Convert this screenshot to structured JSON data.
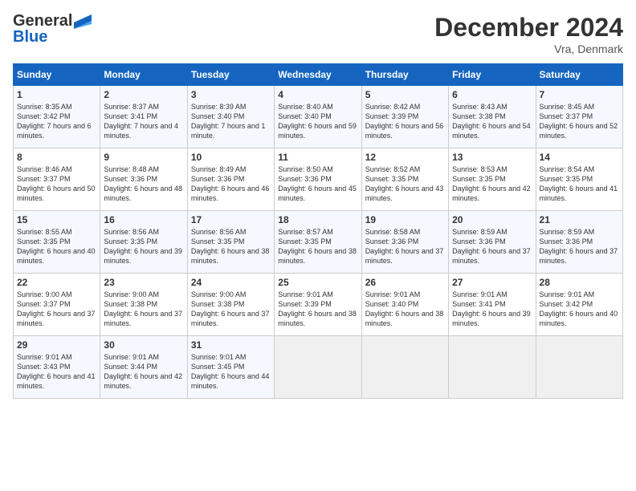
{
  "header": {
    "logo_general": "General",
    "logo_blue": "Blue",
    "month_title": "December 2024",
    "location": "Vra, Denmark"
  },
  "days_of_week": [
    "Sunday",
    "Monday",
    "Tuesday",
    "Wednesday",
    "Thursday",
    "Friday",
    "Saturday"
  ],
  "weeks": [
    [
      {
        "day": "1",
        "sunrise": "8:35 AM",
        "sunset": "3:42 PM",
        "daylight": "7 hours and 6 minutes."
      },
      {
        "day": "2",
        "sunrise": "8:37 AM",
        "sunset": "3:41 PM",
        "daylight": "7 hours and 4 minutes."
      },
      {
        "day": "3",
        "sunrise": "8:39 AM",
        "sunset": "3:40 PM",
        "daylight": "7 hours and 1 minute."
      },
      {
        "day": "4",
        "sunrise": "8:40 AM",
        "sunset": "3:40 PM",
        "daylight": "6 hours and 59 minutes."
      },
      {
        "day": "5",
        "sunrise": "8:42 AM",
        "sunset": "3:39 PM",
        "daylight": "6 hours and 56 minutes."
      },
      {
        "day": "6",
        "sunrise": "8:43 AM",
        "sunset": "3:38 PM",
        "daylight": "6 hours and 54 minutes."
      },
      {
        "day": "7",
        "sunrise": "8:45 AM",
        "sunset": "3:37 PM",
        "daylight": "6 hours and 52 minutes."
      }
    ],
    [
      {
        "day": "8",
        "sunrise": "8:46 AM",
        "sunset": "3:37 PM",
        "daylight": "6 hours and 50 minutes."
      },
      {
        "day": "9",
        "sunrise": "8:48 AM",
        "sunset": "3:36 PM",
        "daylight": "6 hours and 48 minutes."
      },
      {
        "day": "10",
        "sunrise": "8:49 AM",
        "sunset": "3:36 PM",
        "daylight": "6 hours and 46 minutes."
      },
      {
        "day": "11",
        "sunrise": "8:50 AM",
        "sunset": "3:36 PM",
        "daylight": "6 hours and 45 minutes."
      },
      {
        "day": "12",
        "sunrise": "8:52 AM",
        "sunset": "3:35 PM",
        "daylight": "6 hours and 43 minutes."
      },
      {
        "day": "13",
        "sunrise": "8:53 AM",
        "sunset": "3:35 PM",
        "daylight": "6 hours and 42 minutes."
      },
      {
        "day": "14",
        "sunrise": "8:54 AM",
        "sunset": "3:35 PM",
        "daylight": "6 hours and 41 minutes."
      }
    ],
    [
      {
        "day": "15",
        "sunrise": "8:55 AM",
        "sunset": "3:35 PM",
        "daylight": "6 hours and 40 minutes."
      },
      {
        "day": "16",
        "sunrise": "8:56 AM",
        "sunset": "3:35 PM",
        "daylight": "6 hours and 39 minutes."
      },
      {
        "day": "17",
        "sunrise": "8:56 AM",
        "sunset": "3:35 PM",
        "daylight": "6 hours and 38 minutes."
      },
      {
        "day": "18",
        "sunrise": "8:57 AM",
        "sunset": "3:35 PM",
        "daylight": "6 hours and 38 minutes."
      },
      {
        "day": "19",
        "sunrise": "8:58 AM",
        "sunset": "3:36 PM",
        "daylight": "6 hours and 37 minutes."
      },
      {
        "day": "20",
        "sunrise": "8:59 AM",
        "sunset": "3:36 PM",
        "daylight": "6 hours and 37 minutes."
      },
      {
        "day": "21",
        "sunrise": "8:59 AM",
        "sunset": "3:36 PM",
        "daylight": "6 hours and 37 minutes."
      }
    ],
    [
      {
        "day": "22",
        "sunrise": "9:00 AM",
        "sunset": "3:37 PM",
        "daylight": "6 hours and 37 minutes."
      },
      {
        "day": "23",
        "sunrise": "9:00 AM",
        "sunset": "3:38 PM",
        "daylight": "6 hours and 37 minutes."
      },
      {
        "day": "24",
        "sunrise": "9:00 AM",
        "sunset": "3:38 PM",
        "daylight": "6 hours and 37 minutes."
      },
      {
        "day": "25",
        "sunrise": "9:01 AM",
        "sunset": "3:39 PM",
        "daylight": "6 hours and 38 minutes."
      },
      {
        "day": "26",
        "sunrise": "9:01 AM",
        "sunset": "3:40 PM",
        "daylight": "6 hours and 38 minutes."
      },
      {
        "day": "27",
        "sunrise": "9:01 AM",
        "sunset": "3:41 PM",
        "daylight": "6 hours and 39 minutes."
      },
      {
        "day": "28",
        "sunrise": "9:01 AM",
        "sunset": "3:42 PM",
        "daylight": "6 hours and 40 minutes."
      }
    ],
    [
      {
        "day": "29",
        "sunrise": "9:01 AM",
        "sunset": "3:43 PM",
        "daylight": "6 hours and 41 minutes."
      },
      {
        "day": "30",
        "sunrise": "9:01 AM",
        "sunset": "3:44 PM",
        "daylight": "6 hours and 42 minutes."
      },
      {
        "day": "31",
        "sunrise": "9:01 AM",
        "sunset": "3:45 PM",
        "daylight": "6 hours and 44 minutes."
      },
      null,
      null,
      null,
      null
    ]
  ]
}
